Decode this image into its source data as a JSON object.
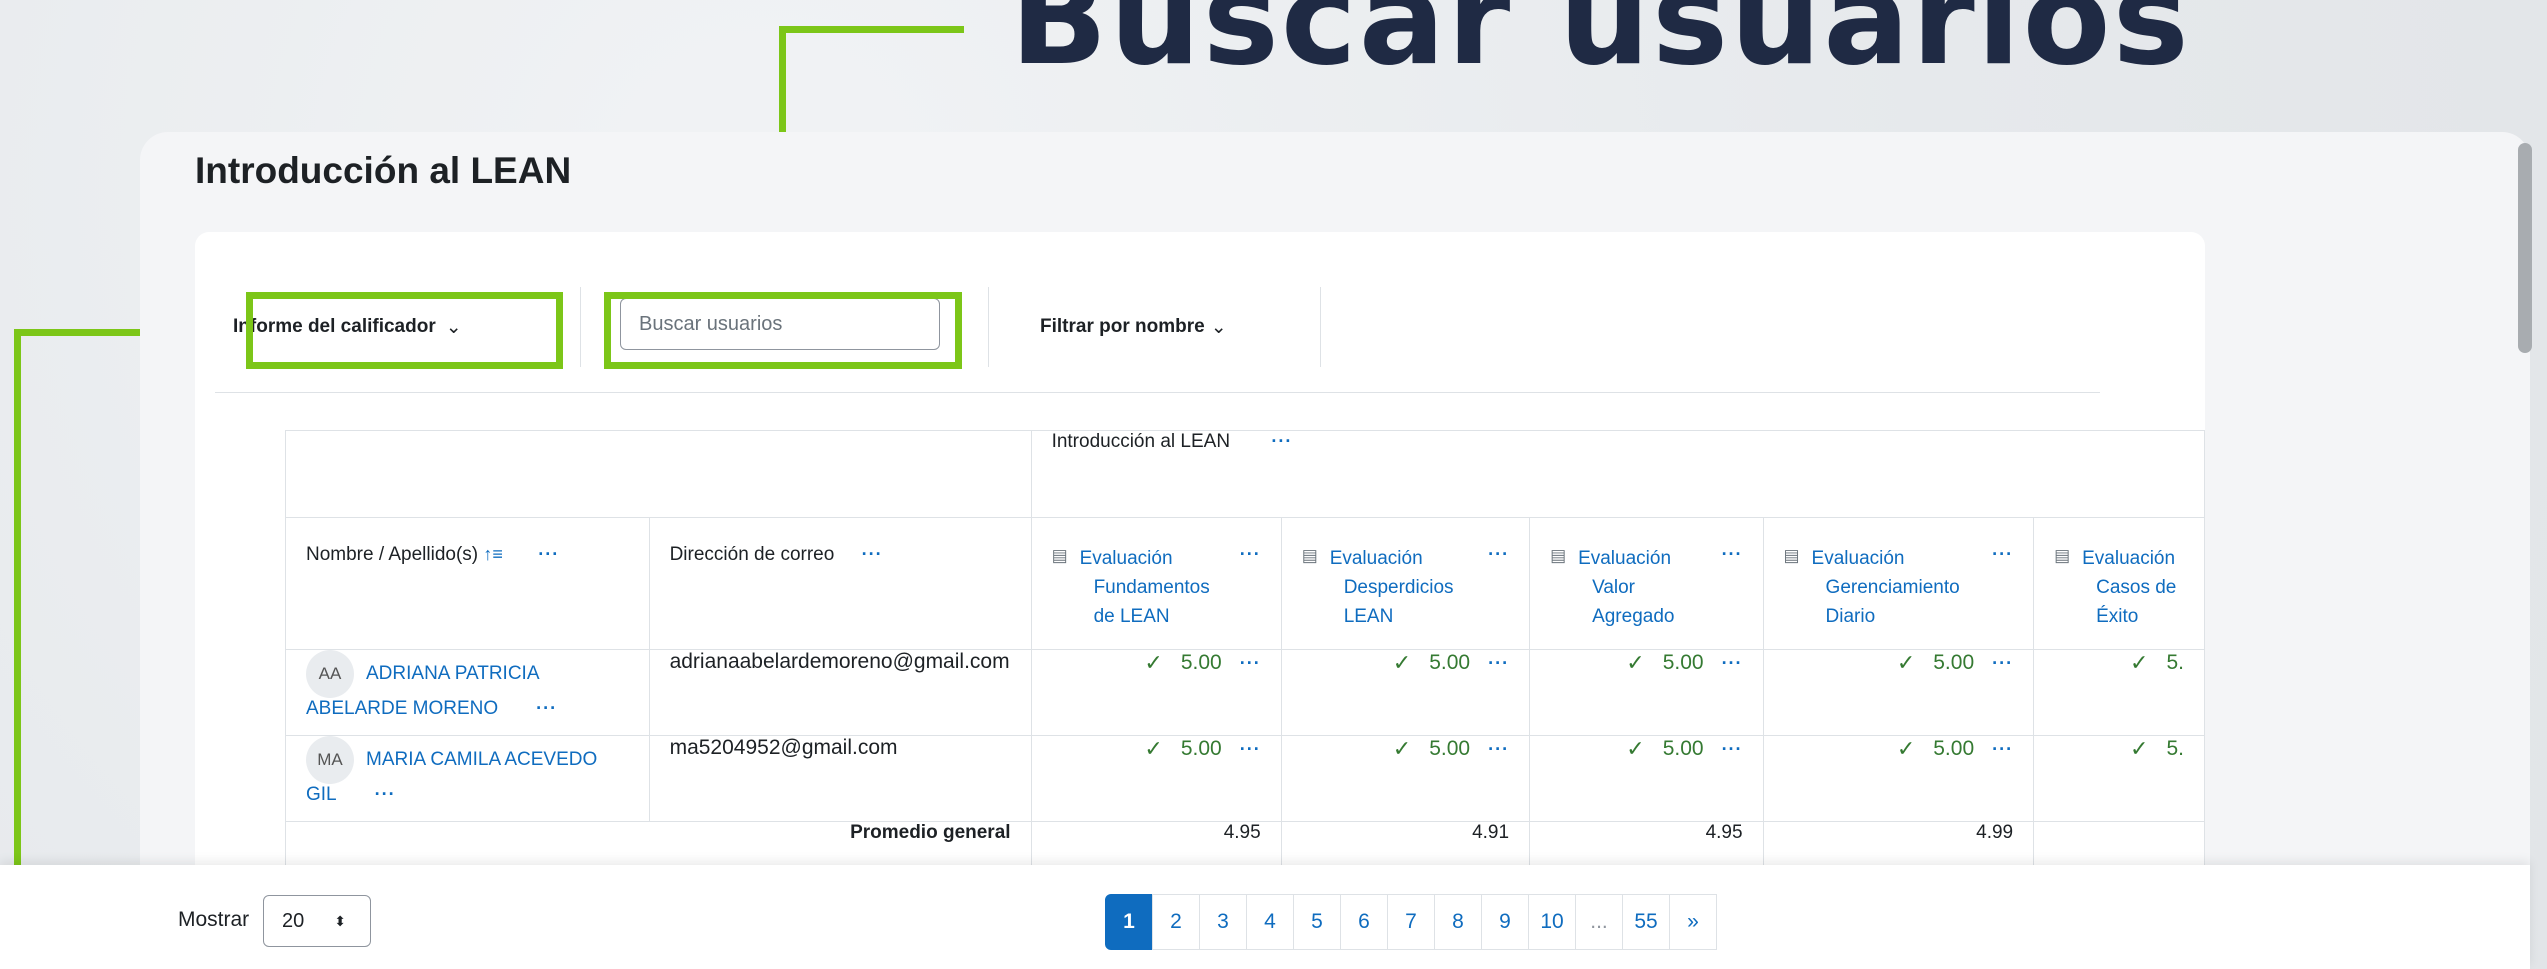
{
  "banner": {
    "title": "Buscar usuarios"
  },
  "course": {
    "title": "Introducción al LEAN"
  },
  "toolbar": {
    "report_label": "Informe del calificador",
    "search_placeholder": "Buscar usuarios",
    "filter_label": "Filtrar por nombre"
  },
  "table": {
    "category_label": "Introducción al LEAN",
    "col_name": "Nombre / Apellido(s)",
    "col_email": "Dirección de correo",
    "items": [
      {
        "lines": [
          "Evaluación",
          "Fundamentos",
          "de LEAN"
        ]
      },
      {
        "lines": [
          "Evaluación",
          "Desperdicios",
          "LEAN"
        ]
      },
      {
        "lines": [
          "Evaluación",
          "Valor",
          "Agregado"
        ]
      },
      {
        "lines": [
          "Evaluación",
          "Gerenciamiento",
          "Diario"
        ]
      },
      {
        "lines": [
          "Evaluación",
          "Casos de",
          "Éxito"
        ]
      }
    ],
    "rows": [
      {
        "initials": "AA",
        "name": "ADRIANA PATRICIA ABELARDE MORENO",
        "email": "adrianaabelardemoreno@gmail.com",
        "grades": [
          "5.00",
          "5.00",
          "5.00",
          "5.00",
          "5."
        ]
      },
      {
        "initials": "MA",
        "name": "MARIA CAMILA ACEVEDO GIL",
        "email": "ma5204952@gmail.com",
        "grades": [
          "5.00",
          "5.00",
          "5.00",
          "5.00",
          "5."
        ]
      }
    ],
    "average_label": "Promedio general",
    "averages": [
      "4.95",
      "4.91",
      "4.95",
      "4.99",
      ""
    ]
  },
  "footer": {
    "show_label": "Mostrar",
    "per_page": "20",
    "pages": [
      "1",
      "2",
      "3",
      "4",
      "5",
      "6",
      "7",
      "8",
      "9",
      "10",
      "...",
      "55",
      "»"
    ],
    "current_page": "1"
  },
  "colors": {
    "accent": "#0f6cbf",
    "highlight": "#7cc618",
    "pass": "#357a32"
  }
}
